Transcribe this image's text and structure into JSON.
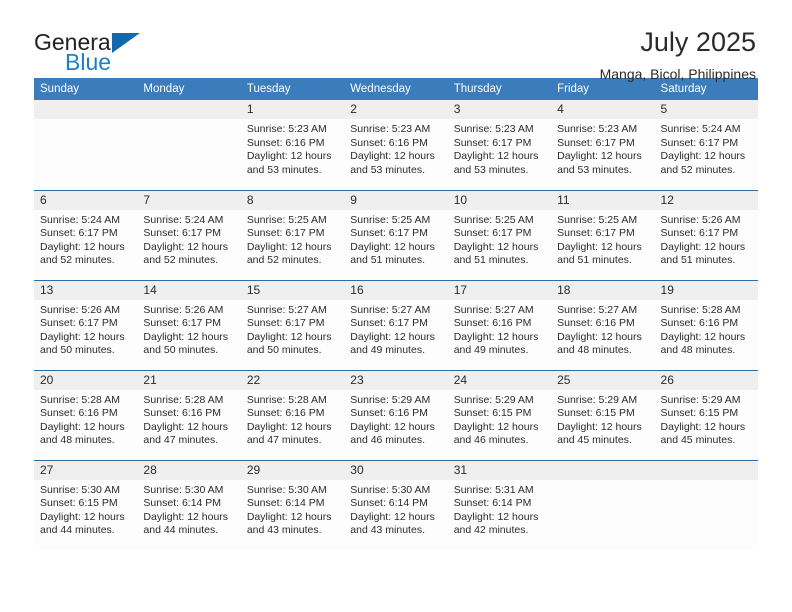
{
  "brand": {
    "name_top": "General",
    "name_bottom": "Blue",
    "accent_color": "#1668ad",
    "text_color": "#231f20"
  },
  "header": {
    "title": "July 2025",
    "subtitle": "Manga, Bicol, Philippines"
  },
  "calendar": {
    "header_bg": "#3b7cbd",
    "row_border_color": "#2e6da4",
    "daynum_bg": "#efefef",
    "weekday_headers": [
      "Sunday",
      "Monday",
      "Tuesday",
      "Wednesday",
      "Thursday",
      "Friday",
      "Saturday"
    ],
    "weeks": [
      [
        {
          "day": "",
          "sunrise": "",
          "sunset": "",
          "daylight": ""
        },
        {
          "day": "",
          "sunrise": "",
          "sunset": "",
          "daylight": ""
        },
        {
          "day": "1",
          "sunrise": "Sunrise: 5:23 AM",
          "sunset": "Sunset: 6:16 PM",
          "daylight": "Daylight: 12 hours and 53 minutes."
        },
        {
          "day": "2",
          "sunrise": "Sunrise: 5:23 AM",
          "sunset": "Sunset: 6:16 PM",
          "daylight": "Daylight: 12 hours and 53 minutes."
        },
        {
          "day": "3",
          "sunrise": "Sunrise: 5:23 AM",
          "sunset": "Sunset: 6:17 PM",
          "daylight": "Daylight: 12 hours and 53 minutes."
        },
        {
          "day": "4",
          "sunrise": "Sunrise: 5:23 AM",
          "sunset": "Sunset: 6:17 PM",
          "daylight": "Daylight: 12 hours and 53 minutes."
        },
        {
          "day": "5",
          "sunrise": "Sunrise: 5:24 AM",
          "sunset": "Sunset: 6:17 PM",
          "daylight": "Daylight: 12 hours and 52 minutes."
        }
      ],
      [
        {
          "day": "6",
          "sunrise": "Sunrise: 5:24 AM",
          "sunset": "Sunset: 6:17 PM",
          "daylight": "Daylight: 12 hours and 52 minutes."
        },
        {
          "day": "7",
          "sunrise": "Sunrise: 5:24 AM",
          "sunset": "Sunset: 6:17 PM",
          "daylight": "Daylight: 12 hours and 52 minutes."
        },
        {
          "day": "8",
          "sunrise": "Sunrise: 5:25 AM",
          "sunset": "Sunset: 6:17 PM",
          "daylight": "Daylight: 12 hours and 52 minutes."
        },
        {
          "day": "9",
          "sunrise": "Sunrise: 5:25 AM",
          "sunset": "Sunset: 6:17 PM",
          "daylight": "Daylight: 12 hours and 51 minutes."
        },
        {
          "day": "10",
          "sunrise": "Sunrise: 5:25 AM",
          "sunset": "Sunset: 6:17 PM",
          "daylight": "Daylight: 12 hours and 51 minutes."
        },
        {
          "day": "11",
          "sunrise": "Sunrise: 5:25 AM",
          "sunset": "Sunset: 6:17 PM",
          "daylight": "Daylight: 12 hours and 51 minutes."
        },
        {
          "day": "12",
          "sunrise": "Sunrise: 5:26 AM",
          "sunset": "Sunset: 6:17 PM",
          "daylight": "Daylight: 12 hours and 51 minutes."
        }
      ],
      [
        {
          "day": "13",
          "sunrise": "Sunrise: 5:26 AM",
          "sunset": "Sunset: 6:17 PM",
          "daylight": "Daylight: 12 hours and 50 minutes."
        },
        {
          "day": "14",
          "sunrise": "Sunrise: 5:26 AM",
          "sunset": "Sunset: 6:17 PM",
          "daylight": "Daylight: 12 hours and 50 minutes."
        },
        {
          "day": "15",
          "sunrise": "Sunrise: 5:27 AM",
          "sunset": "Sunset: 6:17 PM",
          "daylight": "Daylight: 12 hours and 50 minutes."
        },
        {
          "day": "16",
          "sunrise": "Sunrise: 5:27 AM",
          "sunset": "Sunset: 6:17 PM",
          "daylight": "Daylight: 12 hours and 49 minutes."
        },
        {
          "day": "17",
          "sunrise": "Sunrise: 5:27 AM",
          "sunset": "Sunset: 6:16 PM",
          "daylight": "Daylight: 12 hours and 49 minutes."
        },
        {
          "day": "18",
          "sunrise": "Sunrise: 5:27 AM",
          "sunset": "Sunset: 6:16 PM",
          "daylight": "Daylight: 12 hours and 48 minutes."
        },
        {
          "day": "19",
          "sunrise": "Sunrise: 5:28 AM",
          "sunset": "Sunset: 6:16 PM",
          "daylight": "Daylight: 12 hours and 48 minutes."
        }
      ],
      [
        {
          "day": "20",
          "sunrise": "Sunrise: 5:28 AM",
          "sunset": "Sunset: 6:16 PM",
          "daylight": "Daylight: 12 hours and 48 minutes."
        },
        {
          "day": "21",
          "sunrise": "Sunrise: 5:28 AM",
          "sunset": "Sunset: 6:16 PM",
          "daylight": "Daylight: 12 hours and 47 minutes."
        },
        {
          "day": "22",
          "sunrise": "Sunrise: 5:28 AM",
          "sunset": "Sunset: 6:16 PM",
          "daylight": "Daylight: 12 hours and 47 minutes."
        },
        {
          "day": "23",
          "sunrise": "Sunrise: 5:29 AM",
          "sunset": "Sunset: 6:16 PM",
          "daylight": "Daylight: 12 hours and 46 minutes."
        },
        {
          "day": "24",
          "sunrise": "Sunrise: 5:29 AM",
          "sunset": "Sunset: 6:15 PM",
          "daylight": "Daylight: 12 hours and 46 minutes."
        },
        {
          "day": "25",
          "sunrise": "Sunrise: 5:29 AM",
          "sunset": "Sunset: 6:15 PM",
          "daylight": "Daylight: 12 hours and 45 minutes."
        },
        {
          "day": "26",
          "sunrise": "Sunrise: 5:29 AM",
          "sunset": "Sunset: 6:15 PM",
          "daylight": "Daylight: 12 hours and 45 minutes."
        }
      ],
      [
        {
          "day": "27",
          "sunrise": "Sunrise: 5:30 AM",
          "sunset": "Sunset: 6:15 PM",
          "daylight": "Daylight: 12 hours and 44 minutes."
        },
        {
          "day": "28",
          "sunrise": "Sunrise: 5:30 AM",
          "sunset": "Sunset: 6:14 PM",
          "daylight": "Daylight: 12 hours and 44 minutes."
        },
        {
          "day": "29",
          "sunrise": "Sunrise: 5:30 AM",
          "sunset": "Sunset: 6:14 PM",
          "daylight": "Daylight: 12 hours and 43 minutes."
        },
        {
          "day": "30",
          "sunrise": "Sunrise: 5:30 AM",
          "sunset": "Sunset: 6:14 PM",
          "daylight": "Daylight: 12 hours and 43 minutes."
        },
        {
          "day": "31",
          "sunrise": "Sunrise: 5:31 AM",
          "sunset": "Sunset: 6:14 PM",
          "daylight": "Daylight: 12 hours and 42 minutes."
        },
        {
          "day": "",
          "sunrise": "",
          "sunset": "",
          "daylight": ""
        },
        {
          "day": "",
          "sunrise": "",
          "sunset": "",
          "daylight": ""
        }
      ]
    ]
  }
}
